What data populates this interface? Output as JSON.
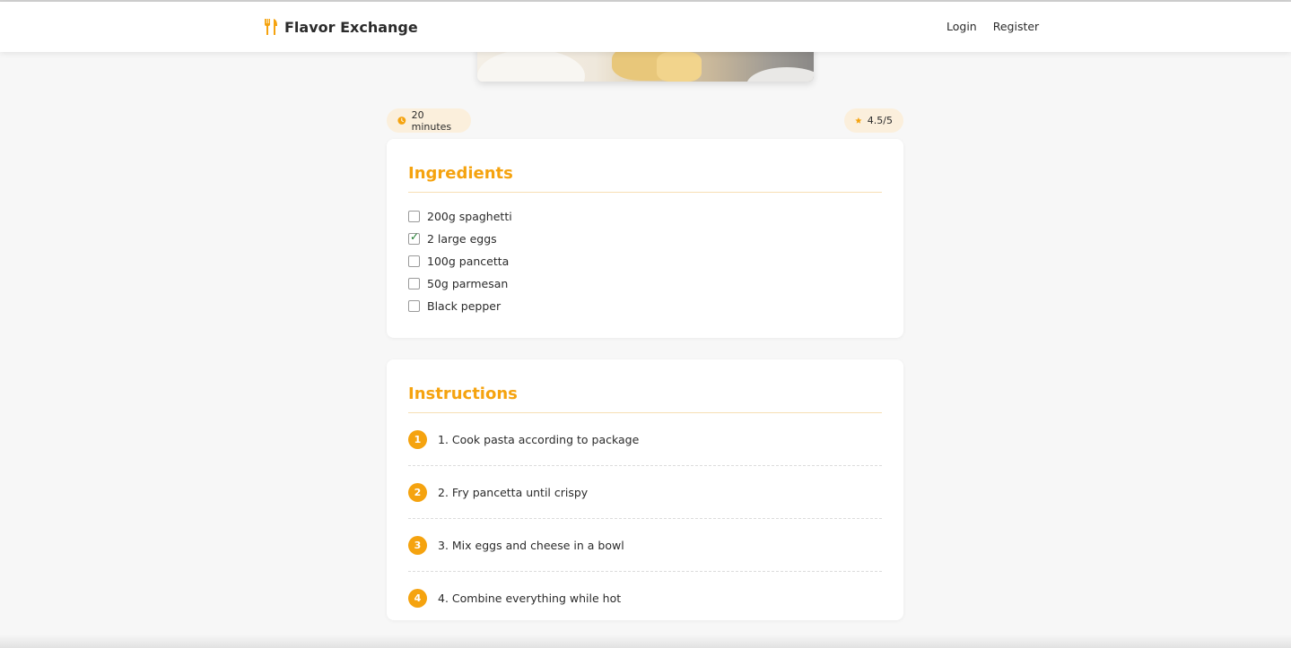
{
  "navbar": {
    "brand_name": "Flavor Exchange",
    "brand_icon": "utensils-icon",
    "links": [
      "Login",
      "Register"
    ]
  },
  "recipe": {
    "time_label": "20 minutes",
    "time_icon": "clock-icon",
    "rating_label": "4.5/5",
    "rating_icon": "star-icon"
  },
  "ingredients": {
    "title": "Ingredients",
    "items": [
      {
        "label": "200g spaghetti",
        "checked": false
      },
      {
        "label": "2 large eggs",
        "checked": true
      },
      {
        "label": "100g pancetta",
        "checked": false
      },
      {
        "label": "50g parmesan",
        "checked": false
      },
      {
        "label": "Black pepper",
        "checked": false
      }
    ]
  },
  "instructions": {
    "title": "Instructions",
    "steps": [
      {
        "num": "1",
        "text": "1. Cook pasta according to package"
      },
      {
        "num": "2",
        "text": "2. Fry pancetta until crispy"
      },
      {
        "num": "3",
        "text": "3. Mix eggs and cheese in a bowl"
      },
      {
        "num": "4",
        "text": "4. Combine everything while hot"
      }
    ]
  },
  "colors": {
    "accent": "#f5a30f",
    "badge_bg": "#fbefdc",
    "page_bg": "#f7f7f7"
  }
}
